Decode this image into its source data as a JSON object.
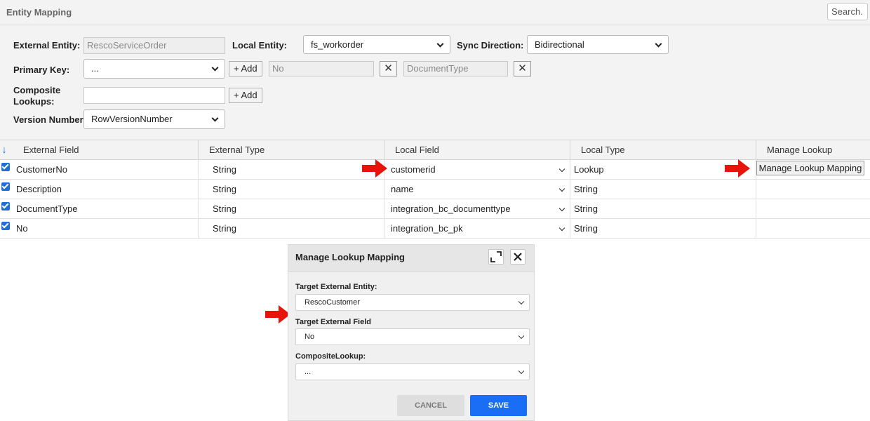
{
  "header": {
    "title": "Entity Mapping",
    "search_placeholder": "Search..."
  },
  "form": {
    "external_entity_label": "External Entity:",
    "external_entity_value": "RescoServiceOrder",
    "local_entity_label": "Local Entity:",
    "local_entity_value": "fs_workorder",
    "sync_direction_label": "Sync Direction:",
    "sync_direction_value": "Bidirectional",
    "primary_key_label": "Primary Key:",
    "primary_key_value": "...",
    "add_label": "+ Add",
    "primary_key_field_1": "No",
    "primary_key_field_2": "DocumentType",
    "composite_lookups_label_1": "Composite",
    "composite_lookups_label_2": "Lookups:",
    "composite_lookups_value": "",
    "version_number_label": "Version Number:",
    "version_number_value": "RowVersionNumber"
  },
  "grid": {
    "columns": [
      "External Field",
      "External Type",
      "Local Field",
      "Local Type",
      "Manage Lookup"
    ],
    "rows": [
      {
        "external_field": "CustomerNo",
        "external_type": "String",
        "local_field": "customerid",
        "local_type": "Lookup",
        "checked": true
      },
      {
        "external_field": "Description",
        "external_type": "String",
        "local_field": "name",
        "local_type": "String",
        "checked": true
      },
      {
        "external_field": "DocumentType",
        "external_type": "String",
        "local_field": "integration_bc_documenttype",
        "local_type": "String",
        "checked": true
      },
      {
        "external_field": "No",
        "external_type": "String",
        "local_field": "integration_bc_pk",
        "local_type": "String",
        "checked": true
      }
    ],
    "manage_lookup_button": "Manage Lookup Mapping"
  },
  "dialog": {
    "title": "Manage Lookup Mapping",
    "target_entity_label": "Target External Entity:",
    "target_entity_value": "RescoCustomer",
    "target_field_label": "Target External Field",
    "target_field_value": "No",
    "composite_label": "CompositeLookup:",
    "composite_value": "...",
    "cancel_label": "CANCEL",
    "save_label": "SAVE"
  },
  "colors": {
    "accent": "#1a6ef5",
    "arrow": "#e8140c",
    "checkbox": "#1f6fd6"
  },
  "icons": [
    "sort-down-icon",
    "chevron-down-icon",
    "close-icon",
    "expand-icon",
    "red-arrow-icon",
    "checkbox-checked-icon"
  ]
}
